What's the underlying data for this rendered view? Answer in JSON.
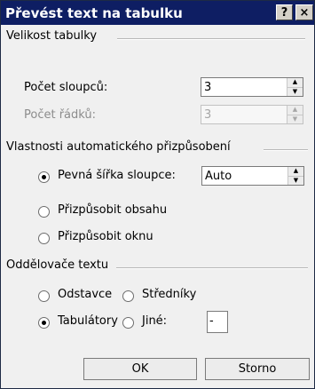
{
  "dialog": {
    "title": "Převést text na tabulku",
    "help_label": "?",
    "close_label": "×"
  },
  "table_size": {
    "legend": "Velikost tabulky",
    "columns_label": "Počet sloupců:",
    "columns_value": "3",
    "rows_label": "Počet řádků:",
    "rows_value": "3",
    "rows_enabled": false
  },
  "autofit": {
    "legend": "Vlastnosti automatického přizpůsobení",
    "fixed_width_label": "Pevná šířka sloupce:",
    "fixed_width_value": "Auto",
    "content_label": "Přizpůsobit obsahu",
    "window_label": "Přizpůsobit oknu",
    "selected": "fixed_width"
  },
  "separators": {
    "legend": "Oddělovače textu",
    "paragraphs_label": "Odstavce",
    "semicolons_label": "Středníky",
    "tabs_label": "Tabulátory",
    "other_label": "Jiné:",
    "other_value": "-",
    "selected": "tabs"
  },
  "buttons": {
    "ok_label": "OK",
    "cancel_label": "Storno"
  },
  "icons": {
    "spin_up": "arrow-up-icon",
    "spin_down": "arrow-down-icon"
  }
}
